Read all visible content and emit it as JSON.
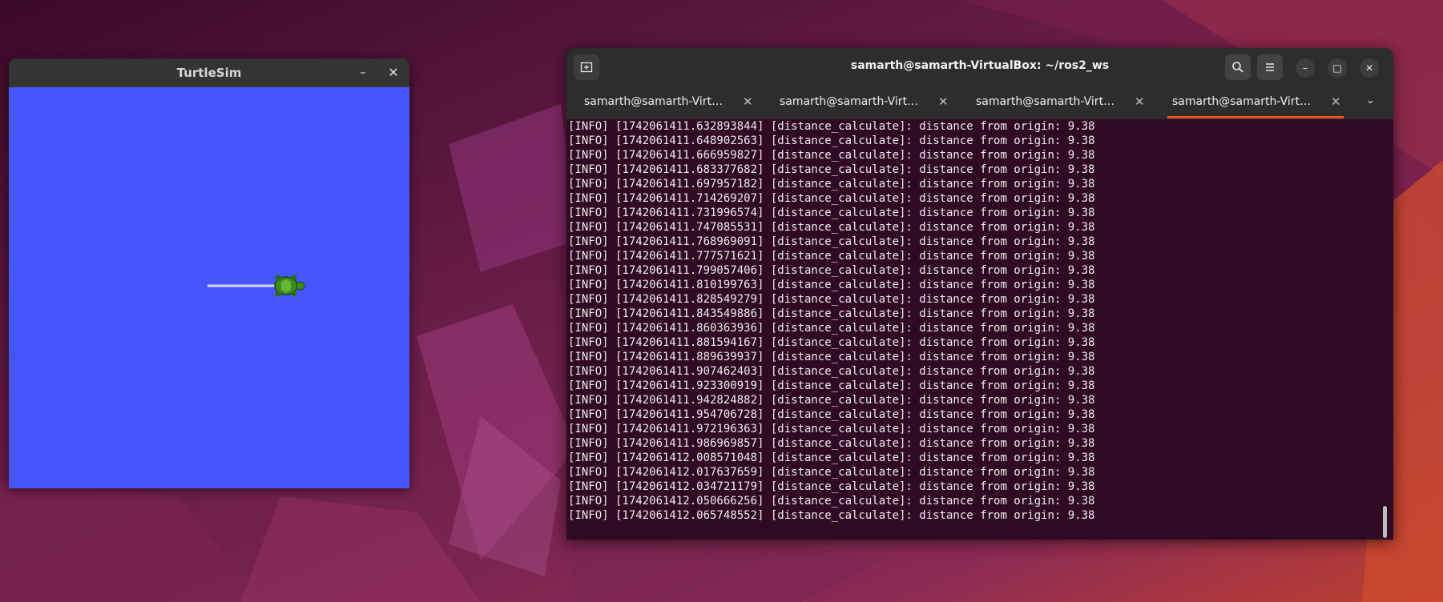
{
  "turtlesim": {
    "title": "TurtleSim",
    "minimize_label": "–",
    "close_label": "✕",
    "background_color": "#4556ff"
  },
  "terminal": {
    "title": "samarth@samarth-VirtualBox: ~/ros2_ws",
    "new_tab_icon": "new-tab-icon",
    "search_icon": "search-icon",
    "menu_icon": "hamburger-menu-icon",
    "minimize_label": "–",
    "maximize_label": "□",
    "close_label": "✕",
    "tabs": [
      {
        "label": "samarth@samarth-Virtu..."
      },
      {
        "label": "samarth@samarth-Virtu..."
      },
      {
        "label": "samarth@samarth-Virtu..."
      },
      {
        "label": "samarth@samarth-Virtu..."
      }
    ],
    "active_tab_index": 3,
    "accent_color": "#e95420",
    "background_color": "#300a24",
    "log_lines": [
      "[INFO] [1742061411.632893844] [distance_calculate]: distance from origin: 9.38",
      "[INFO] [1742061411.648902563] [distance_calculate]: distance from origin: 9.38",
      "[INFO] [1742061411.666959827] [distance_calculate]: distance from origin: 9.38",
      "[INFO] [1742061411.683377682] [distance_calculate]: distance from origin: 9.38",
      "[INFO] [1742061411.697957182] [distance_calculate]: distance from origin: 9.38",
      "[INFO] [1742061411.714269207] [distance_calculate]: distance from origin: 9.38",
      "[INFO] [1742061411.731996574] [distance_calculate]: distance from origin: 9.38",
      "[INFO] [1742061411.747085531] [distance_calculate]: distance from origin: 9.38",
      "[INFO] [1742061411.768969091] [distance_calculate]: distance from origin: 9.38",
      "[INFO] [1742061411.777571621] [distance_calculate]: distance from origin: 9.38",
      "[INFO] [1742061411.799057406] [distance_calculate]: distance from origin: 9.38",
      "[INFO] [1742061411.810199763] [distance_calculate]: distance from origin: 9.38",
      "[INFO] [1742061411.828549279] [distance_calculate]: distance from origin: 9.38",
      "[INFO] [1742061411.843549886] [distance_calculate]: distance from origin: 9.38",
      "[INFO] [1742061411.860363936] [distance_calculate]: distance from origin: 9.38",
      "[INFO] [1742061411.881594167] [distance_calculate]: distance from origin: 9.38",
      "[INFO] [1742061411.889639937] [distance_calculate]: distance from origin: 9.38",
      "[INFO] [1742061411.907462403] [distance_calculate]: distance from origin: 9.38",
      "[INFO] [1742061411.923300919] [distance_calculate]: distance from origin: 9.38",
      "[INFO] [1742061411.942824882] [distance_calculate]: distance from origin: 9.38",
      "[INFO] [1742061411.954706728] [distance_calculate]: distance from origin: 9.38",
      "[INFO] [1742061411.972196363] [distance_calculate]: distance from origin: 9.38",
      "[INFO] [1742061411.986969857] [distance_calculate]: distance from origin: 9.38",
      "[INFO] [1742061412.008571048] [distance_calculate]: distance from origin: 9.38",
      "[INFO] [1742061412.017637659] [distance_calculate]: distance from origin: 9.38",
      "[INFO] [1742061412.034721179] [distance_calculate]: distance from origin: 9.38",
      "[INFO] [1742061412.050666256] [distance_calculate]: distance from origin: 9.38",
      "[INFO] [1742061412.065748552] [distance_calculate]: distance from origin: 9.38"
    ]
  }
}
